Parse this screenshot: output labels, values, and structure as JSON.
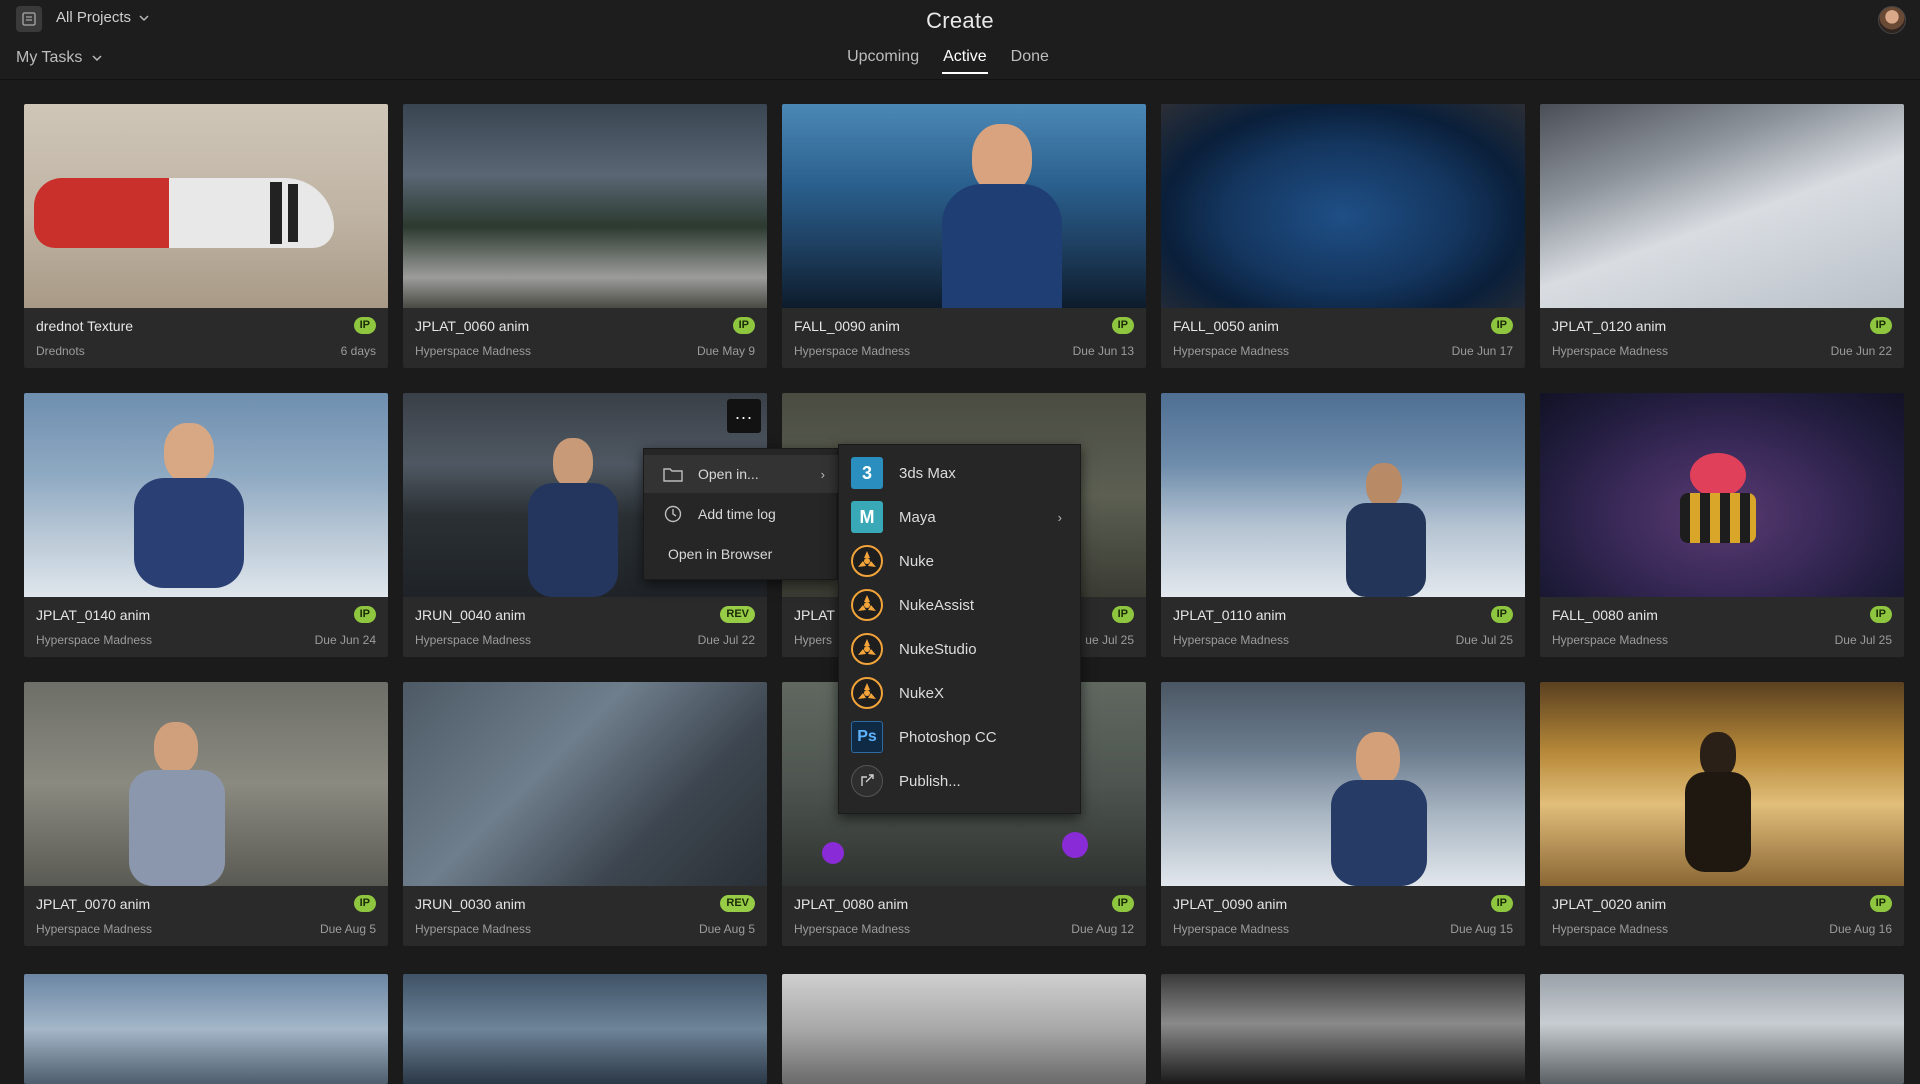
{
  "header": {
    "project_selector": "All Projects",
    "filter": "My Tasks",
    "title": "Create",
    "tabs": [
      {
        "label": "Upcoming",
        "active": false
      },
      {
        "label": "Active",
        "active": true
      },
      {
        "label": "Done",
        "active": false
      }
    ]
  },
  "cards": [
    {
      "title": "drednot Texture",
      "project": "Drednots",
      "due": "6 days",
      "status": "IP"
    },
    {
      "title": "JPLAT_0060 anim",
      "project": "Hyperspace Madness",
      "due": "Due May 9",
      "status": "IP"
    },
    {
      "title": "FALL_0090 anim",
      "project": "Hyperspace Madness",
      "due": "Due Jun 13",
      "status": "IP"
    },
    {
      "title": "FALL_0050 anim",
      "project": "Hyperspace Madness",
      "due": "Due Jun 17",
      "status": "IP"
    },
    {
      "title": "JPLAT_0120 anim",
      "project": "Hyperspace Madness",
      "due": "Due Jun 22",
      "status": "IP"
    },
    {
      "title": "JPLAT_0140 anim",
      "project": "Hyperspace Madness",
      "due": "Due Jun 24",
      "status": "IP"
    },
    {
      "title": "JRUN_0040 anim",
      "project": "Hyperspace Madness",
      "due": "Due Jul 22",
      "status": "REV"
    },
    {
      "title": "JPLAT",
      "project": "Hypers",
      "due": "ue Jul 25",
      "status": "IP"
    },
    {
      "title": "JPLAT_0110 anim",
      "project": "Hyperspace Madness",
      "due": "Due Jul 25",
      "status": "IP"
    },
    {
      "title": "FALL_0080 anim",
      "project": "Hyperspace Madness",
      "due": "Due Jul 25",
      "status": "IP"
    },
    {
      "title": "JPLAT_0070 anim",
      "project": "Hyperspace Madness",
      "due": "Due Aug 5",
      "status": "IP"
    },
    {
      "title": "JRUN_0030 anim",
      "project": "Hyperspace Madness",
      "due": "Due Aug 5",
      "status": "REV"
    },
    {
      "title": "JPLAT_0080 anim",
      "project": "Hyperspace Madness",
      "due": "Due Aug 12",
      "status": "IP"
    },
    {
      "title": "JPLAT_0090 anim",
      "project": "Hyperspace Madness",
      "due": "Due Aug 15",
      "status": "IP"
    },
    {
      "title": "JPLAT_0020 anim",
      "project": "Hyperspace Madness",
      "due": "Due Aug 16",
      "status": "IP"
    }
  ],
  "card_more_label": "...",
  "context_menu": {
    "items": [
      {
        "label": "Open in...",
        "icon": "folder-icon",
        "has_submenu": true
      },
      {
        "label": "Add time log",
        "icon": "clock-icon",
        "has_submenu": false
      },
      {
        "label": "Open in Browser",
        "icon": "",
        "has_submenu": false
      }
    ]
  },
  "submenu": {
    "items": [
      {
        "label": "3ds Max",
        "icon": "3dsmax-icon",
        "glyph": "3",
        "color": "#2a8fbf",
        "has_submenu": false
      },
      {
        "label": "Maya",
        "icon": "maya-icon",
        "glyph": "M",
        "color": "#3aa9b7",
        "has_submenu": true
      },
      {
        "label": "Nuke",
        "icon": "nuke-icon",
        "glyph": "",
        "color": "#f2a33a",
        "has_submenu": false
      },
      {
        "label": "NukeAssist",
        "icon": "nukeassist-icon",
        "glyph": "",
        "color": "#f2a33a",
        "has_submenu": false
      },
      {
        "label": "NukeStudio",
        "icon": "nukestudio-icon",
        "glyph": "",
        "color": "#f2a33a",
        "has_submenu": false
      },
      {
        "label": "NukeX",
        "icon": "nukex-icon",
        "glyph": "",
        "color": "#f2a33a",
        "has_submenu": false
      },
      {
        "label": "Photoshop CC",
        "icon": "photoshop-icon",
        "glyph": "Ps",
        "color": "#0f2a44",
        "has_submenu": false
      },
      {
        "label": "Publish...",
        "icon": "publish-icon",
        "glyph": "",
        "color": "#3a3a3a",
        "has_submenu": false
      }
    ]
  },
  "colors": {
    "background": "#1b1b1b",
    "card": "#2a2a2a",
    "status_badge": "#8fc63f"
  }
}
